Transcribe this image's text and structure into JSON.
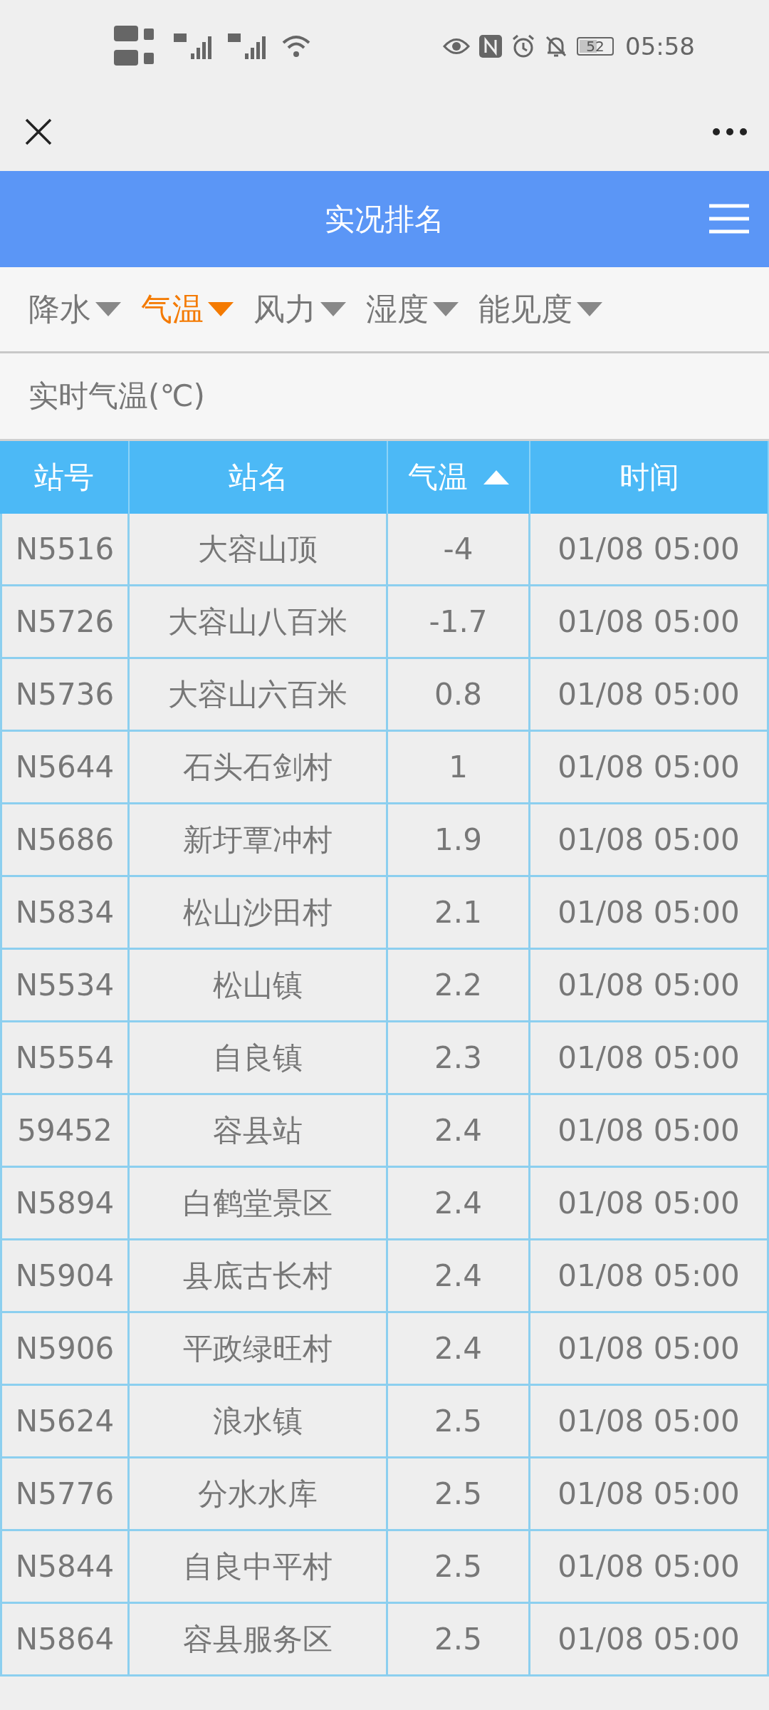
{
  "status_bar": {
    "battery": "52",
    "time": "05:58"
  },
  "header": {
    "title": "实况排名"
  },
  "tabs": [
    {
      "label": "降水",
      "selected": false
    },
    {
      "label": "气温",
      "selected": true
    },
    {
      "label": "风力",
      "selected": false
    },
    {
      "label": "湿度",
      "selected": false
    },
    {
      "label": "能见度",
      "selected": false
    }
  ],
  "subtitle": "实时气温(℃)",
  "table": {
    "columns": [
      {
        "label": "站号",
        "sorted": false
      },
      {
        "label": "站名",
        "sorted": false
      },
      {
        "label": "气温",
        "sorted": true
      },
      {
        "label": "时间",
        "sorted": false
      }
    ],
    "rows": [
      [
        "N5516",
        "大容山顶",
        "-4",
        "01/08 05:00"
      ],
      [
        "N5726",
        "大容山八百米",
        "-1.7",
        "01/08 05:00"
      ],
      [
        "N5736",
        "大容山六百米",
        "0.8",
        "01/08 05:00"
      ],
      [
        "N5644",
        "石头石剑村",
        "1",
        "01/08 05:00"
      ],
      [
        "N5686",
        "新圩覃冲村",
        "1.9",
        "01/08 05:00"
      ],
      [
        "N5834",
        "松山沙田村",
        "2.1",
        "01/08 05:00"
      ],
      [
        "N5534",
        "松山镇",
        "2.2",
        "01/08 05:00"
      ],
      [
        "N5554",
        "自良镇",
        "2.3",
        "01/08 05:00"
      ],
      [
        "59452",
        "容县站",
        "2.4",
        "01/08 05:00"
      ],
      [
        "N5894",
        "白鹤堂景区",
        "2.4",
        "01/08 05:00"
      ],
      [
        "N5904",
        "县底古长村",
        "2.4",
        "01/08 05:00"
      ],
      [
        "N5906",
        "平政绿旺村",
        "2.4",
        "01/08 05:00"
      ],
      [
        "N5624",
        "浪水镇",
        "2.5",
        "01/08 05:00"
      ],
      [
        "N5776",
        "分水水库",
        "2.5",
        "01/08 05:00"
      ],
      [
        "N5844",
        "自良中平村",
        "2.5",
        "01/08 05:00"
      ],
      [
        "N5864",
        "容县服务区",
        "2.5",
        "01/08 05:00"
      ]
    ]
  }
}
